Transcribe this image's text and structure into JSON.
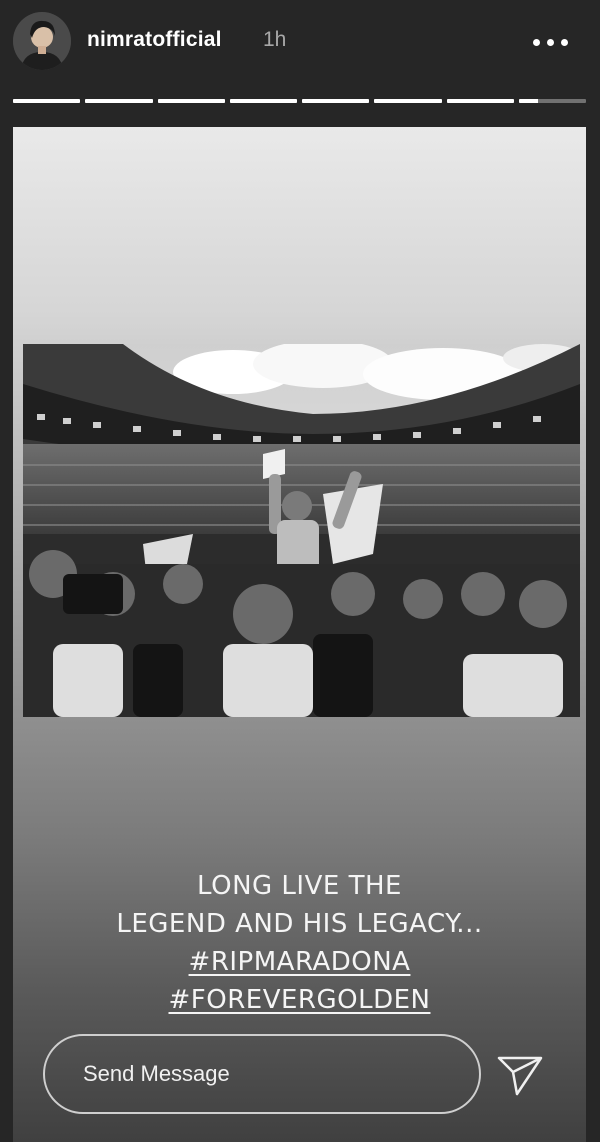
{
  "header": {
    "username": "nimratofficial",
    "time": "1h",
    "avatar_icon": "user-avatar-icon",
    "more_icon": "more-horizontal-icon"
  },
  "progress": {
    "segments": 8,
    "completed": 7,
    "current_fraction": 0.28
  },
  "story": {
    "image_icon": "stadium-celebration-photo",
    "caption": {
      "line1": "LONG LIVE THE",
      "line2": "LEGEND AND HIS LEGACY...",
      "tag1": "#RIPMARADONA",
      "tag2": "#FOREVERGOLDEN"
    }
  },
  "reply": {
    "placeholder": "Send Message",
    "send_icon": "paper-plane-icon"
  },
  "colors": {
    "background": "#262626",
    "text": "#ffffff",
    "muted": "#a8a8a8"
  }
}
